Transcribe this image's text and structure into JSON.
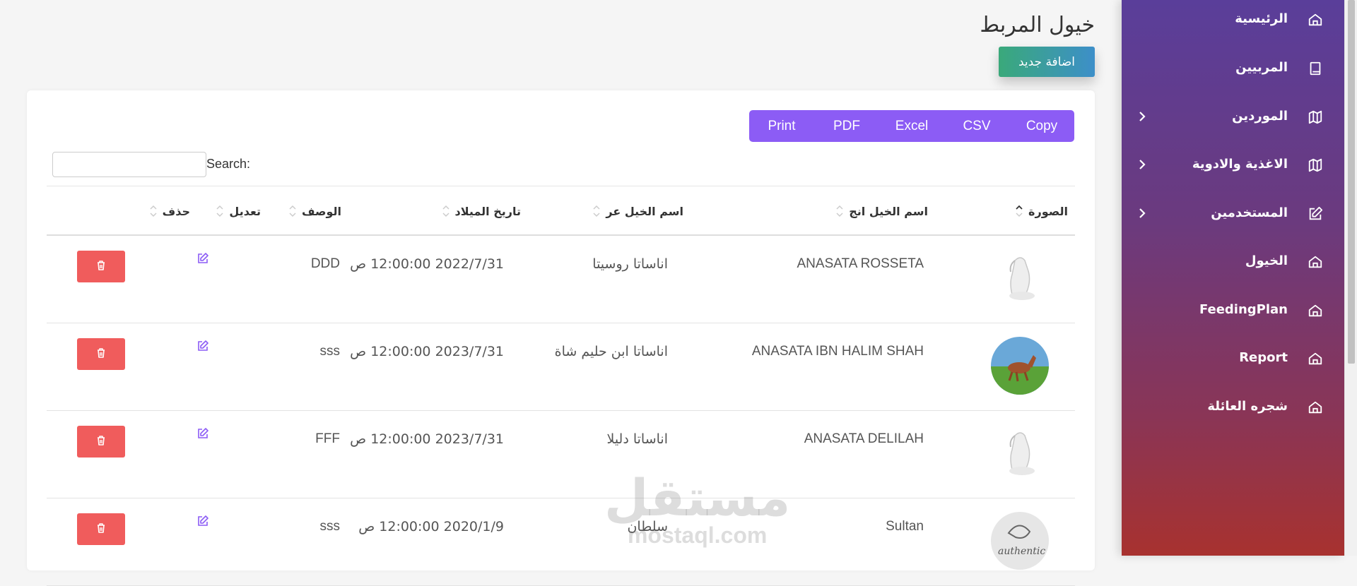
{
  "sidebar": {
    "items": [
      {
        "label": "الرئيسية",
        "icon": "home-icon",
        "chevron": false
      },
      {
        "label": "المربيين",
        "icon": "book-icon",
        "chevron": false
      },
      {
        "label": "الموردين",
        "icon": "map-icon",
        "chevron": true
      },
      {
        "label": "الاغذية والادوية",
        "icon": "map-icon",
        "chevron": true
      },
      {
        "label": "المستخدمين",
        "icon": "edit-icon",
        "chevron": true
      },
      {
        "label": "الخيول",
        "icon": "home-icon",
        "chevron": false
      },
      {
        "label": "FeedingPlan",
        "icon": "home-icon",
        "chevron": false
      },
      {
        "label": "Report",
        "icon": "home-icon",
        "chevron": false
      },
      {
        "label": "شجره العائلة",
        "icon": "home-icon",
        "chevron": false
      }
    ]
  },
  "header": {
    "title": "خيول المربط",
    "add_label": "اضافة جديد"
  },
  "export_buttons": [
    "Copy",
    "CSV",
    "Excel",
    "PDF",
    "Print"
  ],
  "search": {
    "label": "Search:"
  },
  "table": {
    "columns": [
      "الصورة",
      "اسم الخيل انج",
      "اسم الخيل عر",
      "تاريخ الميلاد",
      "الوصف",
      "تعديل",
      "حذف"
    ],
    "rows": [
      {
        "image": "white-horse",
        "name_en": "ANASATA ROSSETA",
        "name_ar": "اناساتا روسيتا",
        "birth": "2022/7/31 12:00:00 ص",
        "desc": "DDD"
      },
      {
        "image": "brown-horse-field",
        "name_en": "ANASATA IBN HALIM SHAH",
        "name_ar": "اناساتا ابن حليم شاة",
        "birth": "2023/7/31 12:00:00 ص",
        "desc": "sss"
      },
      {
        "image": "white-horse",
        "name_en": "ANASATA DELILAH",
        "name_ar": "اناساتا دليلا",
        "birth": "2023/7/31 12:00:00 ص",
        "desc": "FFF"
      },
      {
        "image": "authentic-logo",
        "name_en": "Sultan",
        "name_ar": "سلطان",
        "birth": "2020/1/9 12:00:00 ص",
        "desc": "sss"
      }
    ]
  },
  "watermark": {
    "ar": "مستقل",
    "en": "mostaql.com"
  },
  "colors": {
    "accent": "#8c5cf5",
    "danger": "#f05c5c",
    "add_start": "#3aa97a",
    "add_end": "#3d8fc9"
  }
}
